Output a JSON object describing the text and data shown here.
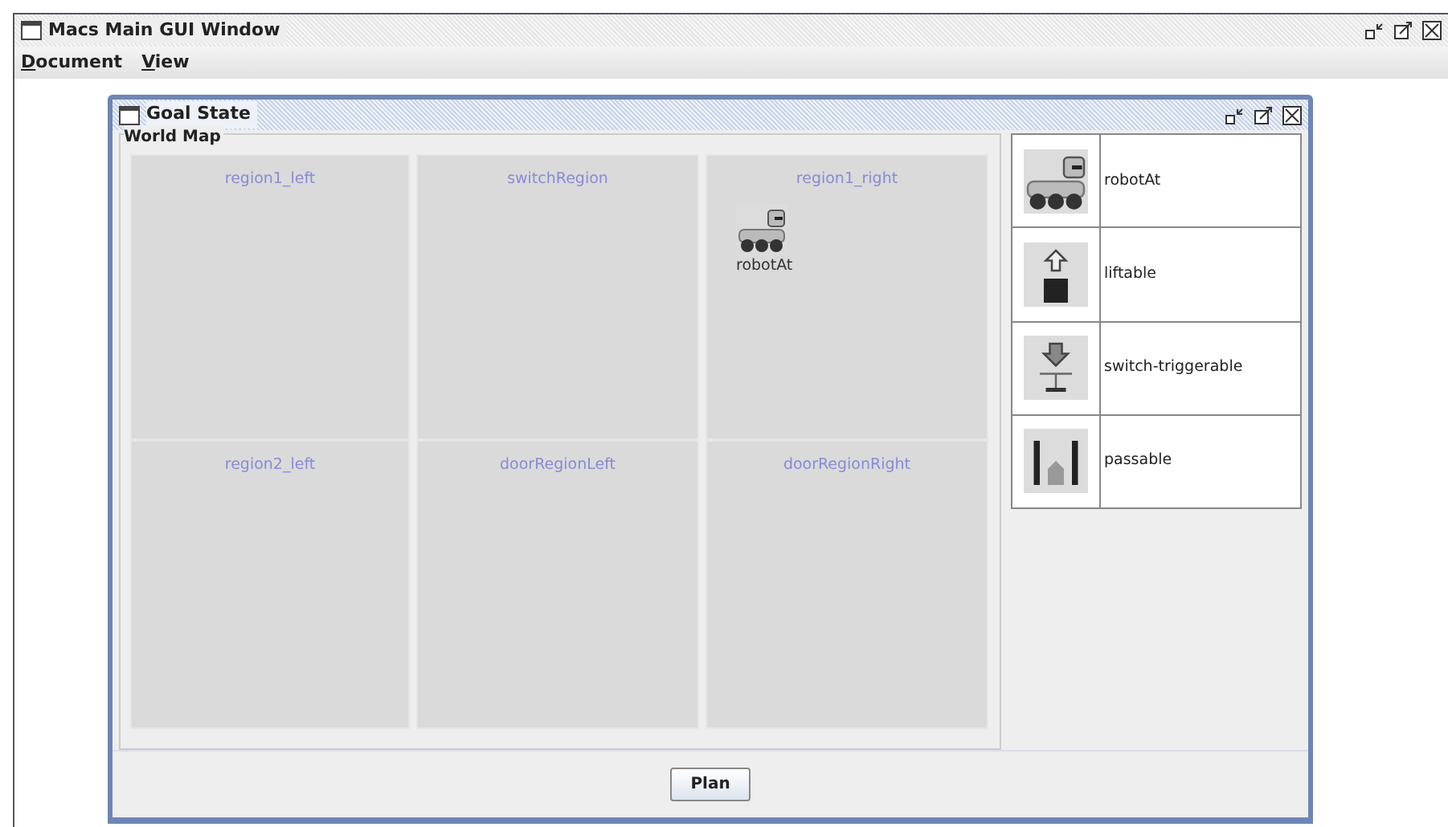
{
  "window": {
    "title": "Macs Main GUI Window"
  },
  "menu": [
    {
      "label": "Document"
    },
    {
      "label": "View"
    }
  ],
  "frame": {
    "title": "Goal State"
  },
  "world_map": {
    "title": "World Map",
    "regions": [
      {
        "name": "region1_left"
      },
      {
        "name": "switchRegion"
      },
      {
        "name": "region1_right",
        "items": [
          {
            "kind": "robot",
            "label": "robotAt"
          }
        ]
      },
      {
        "name": "region2_left"
      },
      {
        "name": "doorRegionLeft"
      },
      {
        "name": "doorRegionRight"
      }
    ]
  },
  "legend": [
    {
      "kind": "robot",
      "label": "robotAt"
    },
    {
      "kind": "liftable",
      "label": "liftable"
    },
    {
      "kind": "switch",
      "label": "switch-triggerable"
    },
    {
      "kind": "passable",
      "label": "passable"
    }
  ],
  "buttons": [
    "Plan"
  ]
}
